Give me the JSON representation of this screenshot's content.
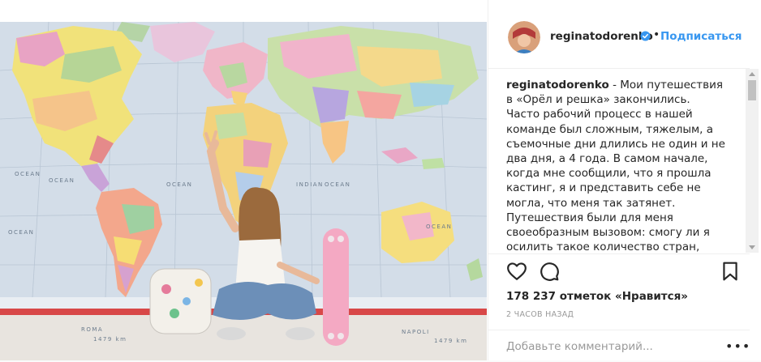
{
  "post": {
    "username": "reginatodorenko",
    "verified": true,
    "dot": "•",
    "follow_label": "Подписаться",
    "caption_user": "reginatodorenko",
    "caption_text": " - Мои путешествия в «Орёл и решка» закончились. Часто рабочий процесс в нашей команде был сложным, тяжелым, а съемочные дни длились не один и не два дня, а 4 года. В самом начале, когда мне сообщили, что я прошла кастинг, я и представить себе не могла, что меня так затянет. Путешествия были для меня своеобразным вызовом: смогу ли я осилить такое количество стран, покорится ли мне следующая страна,",
    "likes": "178 237 отметок «Нравится»",
    "time": "2 ЧАСОВ НАЗАД",
    "comment_placeholder": "Добавьте комментарий...",
    "more": "•••"
  },
  "photo": {
    "map_labels": {
      "ocean_w": "OCEAN",
      "ocean_w2": "OCEAN",
      "ocean_c": "OCEAN",
      "indian": "INDIAN",
      "ocean_c2": "OCEAN",
      "ocean_e": "OCEAN",
      "ocean_sw": "OCEAN",
      "roma": "ROMA",
      "napoli": "NAPOLI",
      "dist1": "1479 km",
      "dist2": "1479 km"
    }
  },
  "icons": [
    "heart-icon",
    "comment-icon",
    "bookmark-icon",
    "verified-badge-icon"
  ],
  "colors": {
    "link": "#3897f0",
    "text": "#262626",
    "muted": "#999999",
    "border": "#efefef"
  }
}
